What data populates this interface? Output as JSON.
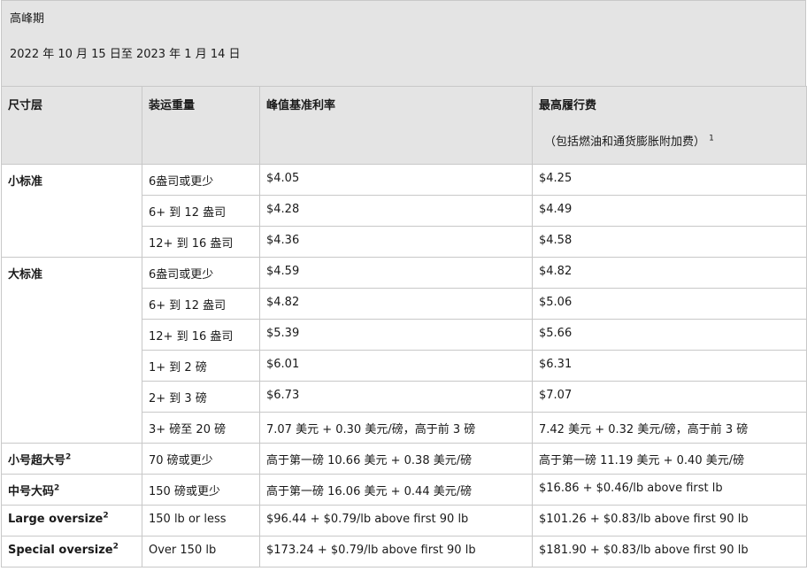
{
  "banner": {
    "period_title": "高峰期",
    "date_range": "2022 年 10 月 15 日至 2023 年 1 月 14 日"
  },
  "headers": {
    "tier": "尺寸层",
    "weight": "装运重量",
    "base_rate": "峰值基准利率",
    "max_fee": "最高履行费",
    "max_fee_note": "（包括燃油和通货膨胀附加费）",
    "max_fee_sup": "1"
  },
  "rows": [
    {
      "tier": "小标准",
      "tier_sup": "",
      "weight": "6盎司或更少",
      "base": "$4.05",
      "max": "$4.25"
    },
    {
      "tier": "",
      "tier_sup": "",
      "weight": "6+ 到 12 盎司",
      "base": "$4.28",
      "max": "$4.49"
    },
    {
      "tier": "",
      "tier_sup": "",
      "weight": "12+ 到 16 盎司",
      "base": "$4.36",
      "max": "$4.58"
    },
    {
      "tier": "大标准",
      "tier_sup": "",
      "weight": "6盎司或更少",
      "base": "$4.59",
      "max": "$4.82"
    },
    {
      "tier": "",
      "tier_sup": "",
      "weight": "6+ 到 12 盎司",
      "base": "$4.82",
      "max": "$5.06"
    },
    {
      "tier": "",
      "tier_sup": "",
      "weight": "12+ 到 16 盎司",
      "base": "$5.39",
      "max": "$5.66"
    },
    {
      "tier": "",
      "tier_sup": "",
      "weight": "1+ 到 2 磅",
      "base": "$6.01",
      "max": "$6.31"
    },
    {
      "tier": "",
      "tier_sup": "",
      "weight": "2+ 到 3 磅",
      "base": "$6.73",
      "max": "$7.07"
    },
    {
      "tier": "",
      "tier_sup": "",
      "weight": "3+ 磅至 20 磅",
      "base": "7.07 美元 + 0.30 美元/磅，高于前 3 磅",
      "max": "7.42 美元 + 0.32 美元/磅，高于前 3 磅"
    },
    {
      "tier": "小号超大号",
      "tier_sup": "2",
      "weight": "70 磅或更少",
      "base": "高于第一磅 10.66 美元 + 0.38 美元/磅",
      "max": "高于第一磅 11.19 美元 + 0.40 美元/磅"
    },
    {
      "tier": "中号大码",
      "tier_sup": "2",
      "weight": "150 磅或更少",
      "base": "高于第一磅 16.06 美元 + 0.44 美元/磅",
      "max": "$16.86 + $0.46/lb above first lb"
    },
    {
      "tier": "Large oversize",
      "tier_sup": "2",
      "weight": "150 lb or less",
      "base": "$96.44 + $0.79/lb above first 90 lb",
      "max": "$101.26 + $0.83/lb above first 90 lb"
    },
    {
      "tier": "Special oversize",
      "tier_sup": "2",
      "weight": "Over 150 lb",
      "base": "$173.24 + $0.79/lb above first 90 lb",
      "max": "$181.90 + $0.83/lb above first 90 lb"
    }
  ]
}
